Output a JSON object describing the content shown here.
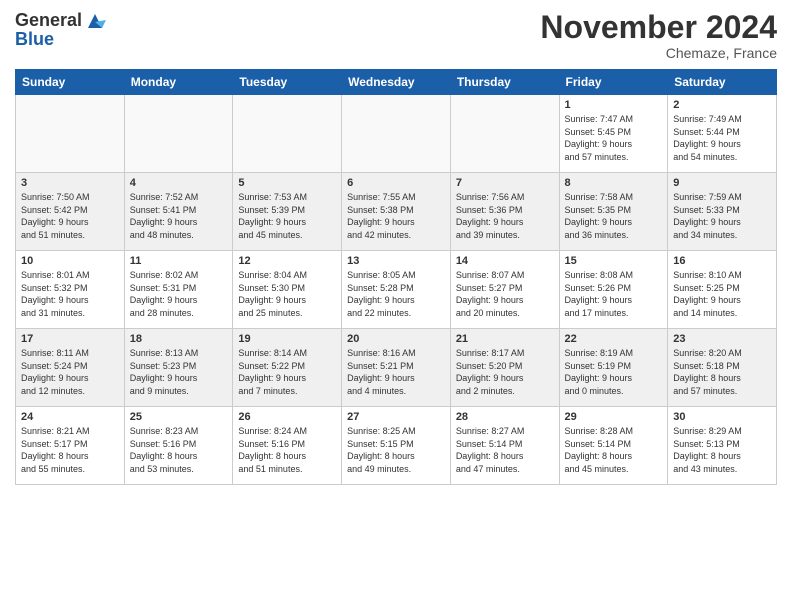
{
  "logo": {
    "general": "General",
    "blue": "Blue"
  },
  "title": "November 2024",
  "location": "Chemaze, France",
  "days_of_week": [
    "Sunday",
    "Monday",
    "Tuesday",
    "Wednesday",
    "Thursday",
    "Friday",
    "Saturday"
  ],
  "weeks": [
    {
      "shaded": false,
      "days": [
        {
          "num": "",
          "info": ""
        },
        {
          "num": "",
          "info": ""
        },
        {
          "num": "",
          "info": ""
        },
        {
          "num": "",
          "info": ""
        },
        {
          "num": "",
          "info": ""
        },
        {
          "num": "1",
          "info": "Sunrise: 7:47 AM\nSunset: 5:45 PM\nDaylight: 9 hours\nand 57 minutes."
        },
        {
          "num": "2",
          "info": "Sunrise: 7:49 AM\nSunset: 5:44 PM\nDaylight: 9 hours\nand 54 minutes."
        }
      ]
    },
    {
      "shaded": true,
      "days": [
        {
          "num": "3",
          "info": "Sunrise: 7:50 AM\nSunset: 5:42 PM\nDaylight: 9 hours\nand 51 minutes."
        },
        {
          "num": "4",
          "info": "Sunrise: 7:52 AM\nSunset: 5:41 PM\nDaylight: 9 hours\nand 48 minutes."
        },
        {
          "num": "5",
          "info": "Sunrise: 7:53 AM\nSunset: 5:39 PM\nDaylight: 9 hours\nand 45 minutes."
        },
        {
          "num": "6",
          "info": "Sunrise: 7:55 AM\nSunset: 5:38 PM\nDaylight: 9 hours\nand 42 minutes."
        },
        {
          "num": "7",
          "info": "Sunrise: 7:56 AM\nSunset: 5:36 PM\nDaylight: 9 hours\nand 39 minutes."
        },
        {
          "num": "8",
          "info": "Sunrise: 7:58 AM\nSunset: 5:35 PM\nDaylight: 9 hours\nand 36 minutes."
        },
        {
          "num": "9",
          "info": "Sunrise: 7:59 AM\nSunset: 5:33 PM\nDaylight: 9 hours\nand 34 minutes."
        }
      ]
    },
    {
      "shaded": false,
      "days": [
        {
          "num": "10",
          "info": "Sunrise: 8:01 AM\nSunset: 5:32 PM\nDaylight: 9 hours\nand 31 minutes."
        },
        {
          "num": "11",
          "info": "Sunrise: 8:02 AM\nSunset: 5:31 PM\nDaylight: 9 hours\nand 28 minutes."
        },
        {
          "num": "12",
          "info": "Sunrise: 8:04 AM\nSunset: 5:30 PM\nDaylight: 9 hours\nand 25 minutes."
        },
        {
          "num": "13",
          "info": "Sunrise: 8:05 AM\nSunset: 5:28 PM\nDaylight: 9 hours\nand 22 minutes."
        },
        {
          "num": "14",
          "info": "Sunrise: 8:07 AM\nSunset: 5:27 PM\nDaylight: 9 hours\nand 20 minutes."
        },
        {
          "num": "15",
          "info": "Sunrise: 8:08 AM\nSunset: 5:26 PM\nDaylight: 9 hours\nand 17 minutes."
        },
        {
          "num": "16",
          "info": "Sunrise: 8:10 AM\nSunset: 5:25 PM\nDaylight: 9 hours\nand 14 minutes."
        }
      ]
    },
    {
      "shaded": true,
      "days": [
        {
          "num": "17",
          "info": "Sunrise: 8:11 AM\nSunset: 5:24 PM\nDaylight: 9 hours\nand 12 minutes."
        },
        {
          "num": "18",
          "info": "Sunrise: 8:13 AM\nSunset: 5:23 PM\nDaylight: 9 hours\nand 9 minutes."
        },
        {
          "num": "19",
          "info": "Sunrise: 8:14 AM\nSunset: 5:22 PM\nDaylight: 9 hours\nand 7 minutes."
        },
        {
          "num": "20",
          "info": "Sunrise: 8:16 AM\nSunset: 5:21 PM\nDaylight: 9 hours\nand 4 minutes."
        },
        {
          "num": "21",
          "info": "Sunrise: 8:17 AM\nSunset: 5:20 PM\nDaylight: 9 hours\nand 2 minutes."
        },
        {
          "num": "22",
          "info": "Sunrise: 8:19 AM\nSunset: 5:19 PM\nDaylight: 9 hours\nand 0 minutes."
        },
        {
          "num": "23",
          "info": "Sunrise: 8:20 AM\nSunset: 5:18 PM\nDaylight: 8 hours\nand 57 minutes."
        }
      ]
    },
    {
      "shaded": false,
      "days": [
        {
          "num": "24",
          "info": "Sunrise: 8:21 AM\nSunset: 5:17 PM\nDaylight: 8 hours\nand 55 minutes."
        },
        {
          "num": "25",
          "info": "Sunrise: 8:23 AM\nSunset: 5:16 PM\nDaylight: 8 hours\nand 53 minutes."
        },
        {
          "num": "26",
          "info": "Sunrise: 8:24 AM\nSunset: 5:16 PM\nDaylight: 8 hours\nand 51 minutes."
        },
        {
          "num": "27",
          "info": "Sunrise: 8:25 AM\nSunset: 5:15 PM\nDaylight: 8 hours\nand 49 minutes."
        },
        {
          "num": "28",
          "info": "Sunrise: 8:27 AM\nSunset: 5:14 PM\nDaylight: 8 hours\nand 47 minutes."
        },
        {
          "num": "29",
          "info": "Sunrise: 8:28 AM\nSunset: 5:14 PM\nDaylight: 8 hours\nand 45 minutes."
        },
        {
          "num": "30",
          "info": "Sunrise: 8:29 AM\nSunset: 5:13 PM\nDaylight: 8 hours\nand 43 minutes."
        }
      ]
    }
  ]
}
